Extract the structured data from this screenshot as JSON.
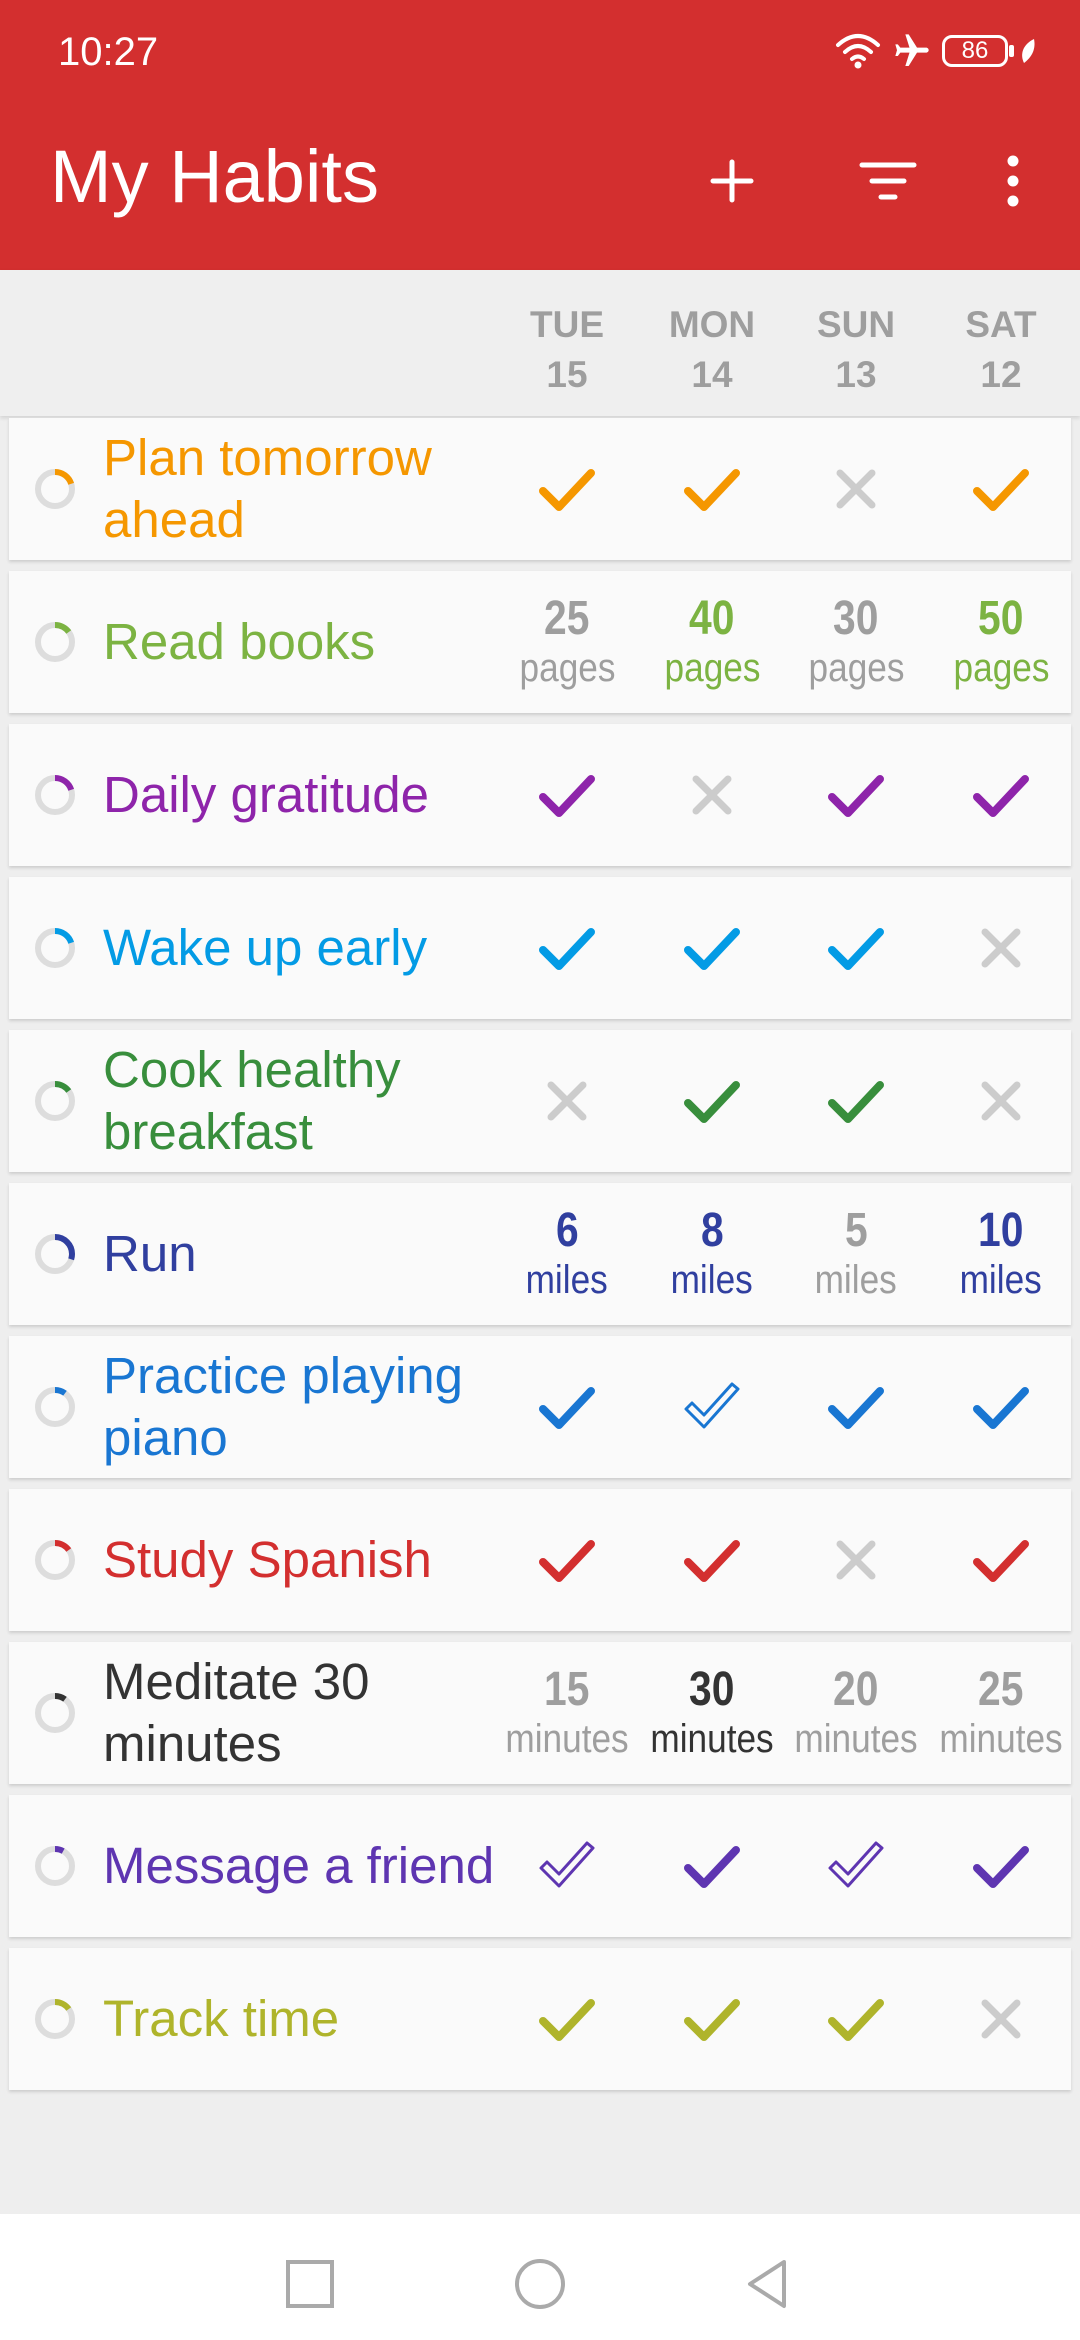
{
  "status_bar": {
    "time": "10:27",
    "battery": "86"
  },
  "app_bar": {
    "title": "My Habits",
    "add_icon": "plus-icon",
    "filter_icon": "filter-icon",
    "more_icon": "more-vert-icon"
  },
  "colors": {
    "app_bar": "#d32f2f",
    "inactive": "#9e9e9e"
  },
  "days": [
    {
      "name": "TUE",
      "date": "15"
    },
    {
      "name": "MON",
      "date": "14"
    },
    {
      "name": "SUN",
      "date": "13"
    },
    {
      "name": "SAT",
      "date": "12"
    }
  ],
  "habits": [
    {
      "name": "Plan tomorrow ahead",
      "color": "#f59700",
      "progress": 0.2,
      "cells": [
        {
          "type": "check"
        },
        {
          "type": "check"
        },
        {
          "type": "cross"
        },
        {
          "type": "check"
        }
      ]
    },
    {
      "name": "Read books",
      "color": "#7cb342",
      "progress": 0.15,
      "cells": [
        {
          "type": "number",
          "value": "25",
          "unit": "pages",
          "met": false
        },
        {
          "type": "number",
          "value": "40",
          "unit": "pages",
          "met": true
        },
        {
          "type": "number",
          "value": "30",
          "unit": "pages",
          "met": false
        },
        {
          "type": "number",
          "value": "50",
          "unit": "pages",
          "met": true
        }
      ]
    },
    {
      "name": "Daily gratitude",
      "color": "#8e24aa",
      "progress": 0.2,
      "cells": [
        {
          "type": "check"
        },
        {
          "type": "cross"
        },
        {
          "type": "check"
        },
        {
          "type": "check"
        }
      ]
    },
    {
      "name": "Wake up early",
      "color": "#039be5",
      "progress": 0.2,
      "cells": [
        {
          "type": "check"
        },
        {
          "type": "check"
        },
        {
          "type": "check"
        },
        {
          "type": "cross"
        }
      ]
    },
    {
      "name": "Cook healthy breakfast",
      "color": "#388e3c",
      "progress": 0.15,
      "cells": [
        {
          "type": "cross"
        },
        {
          "type": "check"
        },
        {
          "type": "check"
        },
        {
          "type": "cross"
        }
      ]
    },
    {
      "name": "Run",
      "color": "#303f9f",
      "progress": 0.3,
      "cells": [
        {
          "type": "number",
          "value": "6",
          "unit": "miles",
          "met": true
        },
        {
          "type": "number",
          "value": "8",
          "unit": "miles",
          "met": true
        },
        {
          "type": "number",
          "value": "5",
          "unit": "miles",
          "met": false
        },
        {
          "type": "number",
          "value": "10",
          "unit": "miles",
          "met": true
        }
      ]
    },
    {
      "name": "Practice playing piano",
      "color": "#1976d2",
      "progress": 0.1,
      "cells": [
        {
          "type": "check"
        },
        {
          "type": "outline"
        },
        {
          "type": "check"
        },
        {
          "type": "check"
        }
      ]
    },
    {
      "name": "Study Spanish",
      "color": "#d32f2f",
      "progress": 0.15,
      "cells": [
        {
          "type": "check"
        },
        {
          "type": "check"
        },
        {
          "type": "cross"
        },
        {
          "type": "check"
        }
      ]
    },
    {
      "name": "Meditate 30 minutes",
      "color": "#333333",
      "progress": 0.1,
      "cells": [
        {
          "type": "number",
          "value": "15",
          "unit": "minutes",
          "met": false
        },
        {
          "type": "number",
          "value": "30",
          "unit": "minutes",
          "met": true
        },
        {
          "type": "number",
          "value": "20",
          "unit": "minutes",
          "met": false
        },
        {
          "type": "number",
          "value": "25",
          "unit": "minutes",
          "met": false
        }
      ]
    },
    {
      "name": "Message a friend",
      "color": "#5e35b1",
      "progress": 0.08,
      "cells": [
        {
          "type": "outline"
        },
        {
          "type": "check"
        },
        {
          "type": "outline"
        },
        {
          "type": "check"
        }
      ]
    },
    {
      "name": "Track time",
      "color": "#afb42b",
      "progress": 0.15,
      "cells": [
        {
          "type": "check"
        },
        {
          "type": "check"
        },
        {
          "type": "check"
        },
        {
          "type": "cross"
        }
      ]
    }
  ],
  "nav_bar": {
    "recents_icon": "square-icon",
    "home_icon": "circle-icon",
    "back_icon": "triangle-back-icon"
  }
}
